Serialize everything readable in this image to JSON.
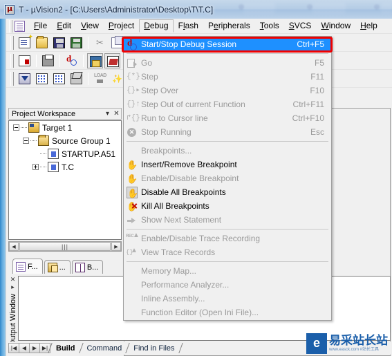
{
  "window": {
    "title": "T - µVision2 - [C:\\Users\\Administrator\\Desktop\\T\\T.C]",
    "app_icon": "uvision-icon"
  },
  "menubar": {
    "items": [
      {
        "label": "File",
        "mnemonic": "F"
      },
      {
        "label": "Edit",
        "mnemonic": "E"
      },
      {
        "label": "View",
        "mnemonic": "V"
      },
      {
        "label": "Project",
        "mnemonic": "P"
      },
      {
        "label": "Debug",
        "mnemonic": "D",
        "open": true
      },
      {
        "label": "Flash",
        "mnemonic": "l"
      },
      {
        "label": "Peripherals",
        "mnemonic": "P"
      },
      {
        "label": "Tools",
        "mnemonic": "T"
      },
      {
        "label": "SVCS",
        "mnemonic": "S"
      },
      {
        "label": "Window",
        "mnemonic": "W"
      },
      {
        "label": "Help",
        "mnemonic": "H"
      }
    ]
  },
  "debug_menu": {
    "groups": [
      {
        "items": [
          {
            "label": "Start/Stop Debug Session",
            "shortcut": "Ctrl+F5",
            "icon": "debug-magnifier-icon",
            "enabled": true,
            "highlighted": true
          }
        ]
      },
      {
        "items": [
          {
            "label": "Go",
            "shortcut": "F5",
            "icon": "go-icon",
            "enabled": false
          },
          {
            "label": "Step",
            "shortcut": "F11",
            "icon": "step-icon",
            "enabled": false
          },
          {
            "label": "Step Over",
            "shortcut": "F10",
            "icon": "step-over-icon",
            "enabled": false
          },
          {
            "label": "Step Out of current Function",
            "shortcut": "Ctrl+F11",
            "icon": "step-out-icon",
            "enabled": false
          },
          {
            "label": "Run to Cursor line",
            "shortcut": "Ctrl+F10",
            "icon": "run-cursor-icon",
            "enabled": false
          },
          {
            "label": "Stop Running",
            "shortcut": "Esc",
            "icon": "stop-icon",
            "enabled": false
          }
        ]
      },
      {
        "items": [
          {
            "label": "Breakpoints...",
            "shortcut": "",
            "icon": "",
            "enabled": false
          },
          {
            "label": "Insert/Remove Breakpoint",
            "shortcut": "",
            "icon": "hand-insert-icon",
            "enabled": true
          },
          {
            "label": "Enable/Disable Breakpoint",
            "shortcut": "",
            "icon": "hand-disabled-icon",
            "enabled": false
          },
          {
            "label": "Disable All Breakpoints",
            "shortcut": "",
            "icon": "hand-boxed-icon",
            "enabled": true
          },
          {
            "label": "Kill All Breakpoints",
            "shortcut": "",
            "icon": "hand-kill-icon",
            "enabled": true
          },
          {
            "label": "Show Next Statement",
            "shortcut": "",
            "icon": "arrow-right-icon",
            "enabled": false
          }
        ]
      },
      {
        "items": [
          {
            "label": "Enable/Disable Trace Recording",
            "shortcut": "",
            "icon": "trace-rec-icon",
            "enabled": false
          },
          {
            "label": "View Trace Records",
            "shortcut": "",
            "icon": "trace-view-icon",
            "enabled": false
          }
        ]
      },
      {
        "items": [
          {
            "label": "Memory Map...",
            "shortcut": "",
            "icon": "",
            "enabled": false
          },
          {
            "label": "Performance Analyzer...",
            "shortcut": "",
            "icon": "",
            "enabled": false
          },
          {
            "label": "Inline Assembly...",
            "shortcut": "",
            "icon": "",
            "enabled": false
          },
          {
            "label": "Function Editor (Open Ini File)...",
            "shortcut": "",
            "icon": "",
            "enabled": false
          }
        ]
      }
    ]
  },
  "toolbars": {
    "row1": [
      {
        "icon": "new-file-icon"
      },
      {
        "icon": "open-file-icon"
      },
      {
        "icon": "save-icon"
      },
      {
        "icon": "save-all-icon"
      },
      {
        "sep": true
      },
      {
        "icon": "cut-icon"
      },
      {
        "icon": "copy-icon"
      },
      {
        "icon": "paste-icon"
      }
    ],
    "row2": [
      {
        "icon": "bookmark-icon"
      },
      {
        "sep": true
      },
      {
        "icon": "print-icon"
      },
      {
        "sep": true
      },
      {
        "icon": "find-in-files-icon"
      },
      {
        "sep": true
      },
      {
        "icon": "project-window-icon",
        "framed": true
      },
      {
        "icon": "output-window-icon",
        "framed": true
      },
      {
        "sep": true
      },
      {
        "icon": "insert-breakpoint-icon"
      }
    ],
    "row3": [
      {
        "icon": "build-icon"
      },
      {
        "icon": "translate-icon"
      },
      {
        "icon": "rebuild-all-icon"
      },
      {
        "icon": "stop-build-icon"
      },
      {
        "sep": true
      },
      {
        "icon": "load-icon"
      },
      {
        "icon": "target-options-icon"
      },
      {
        "icon": "target-select-icon"
      }
    ],
    "target_combo": {
      "value": "",
      "icon": "chevron-down-icon"
    },
    "binoculars_icon": "binoculars-icon"
  },
  "workspace": {
    "title": "Project Workspace",
    "collapse_icon": "chevron-down-icon",
    "close_icon": "close-icon",
    "tree": [
      {
        "label": "Target 1",
        "depth": 0,
        "toggle": "minus",
        "icon": "target-icon"
      },
      {
        "label": "Source Group 1",
        "depth": 1,
        "toggle": "minus",
        "icon": "folder-icon"
      },
      {
        "label": "STARTUP.A51",
        "depth": 2,
        "toggle": "none",
        "icon": "file-icon"
      },
      {
        "label": "T.C",
        "depth": 2,
        "toggle": "plus",
        "icon": "file-icon"
      }
    ],
    "scroll": {
      "left_icon": "arrow-left-icon",
      "right_icon": "arrow-right-icon",
      "grip": "⦙⦙⦙"
    },
    "tabs": [
      {
        "label": "F...",
        "icon": "files-tab-icon",
        "active": true
      },
      {
        "label": "...",
        "icon": "regs-tab-icon",
        "active": false
      },
      {
        "label": "B...",
        "icon": "books-tab-icon",
        "active": false
      }
    ]
  },
  "output_window": {
    "vertical_title": "Output Window",
    "close_icon": "close-icon",
    "collapse_icon": "chevron-down-icon",
    "nav_buttons": [
      "first-icon",
      "prev-icon",
      "next-icon",
      "last-icon"
    ],
    "tabs": [
      {
        "label": "Build",
        "active": true
      },
      {
        "label": "Command",
        "active": false
      },
      {
        "label": "Find in Files",
        "active": false
      }
    ]
  },
  "annotation": {
    "color": "#f00000",
    "target": "Start/Stop Debug Session"
  },
  "watermark": {
    "badge": "e",
    "text": "易采站长站",
    "url": "www.easck.com  #站长工具"
  },
  "colors": {
    "menu_highlight": "#1e90ff",
    "annotation_red": "#f00000",
    "window_border_blue": "#2f86c8",
    "panel_gray": "#f0f0f0"
  }
}
